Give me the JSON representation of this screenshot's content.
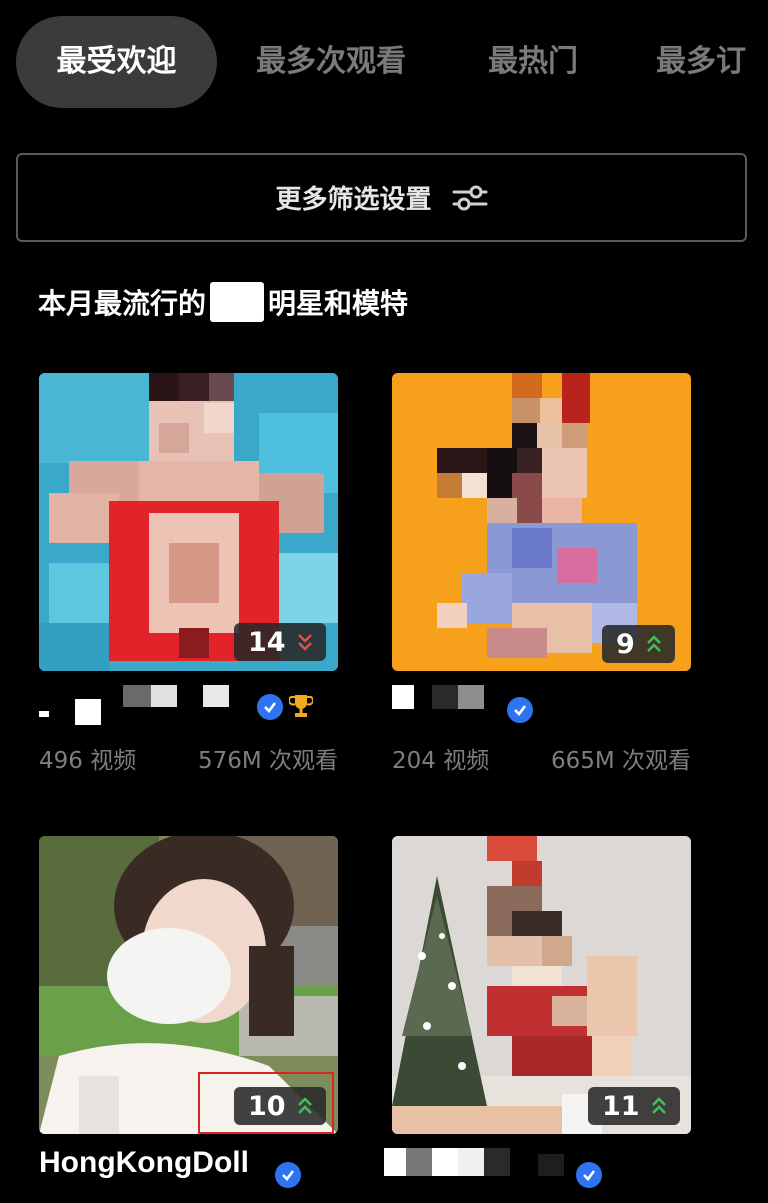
{
  "tabs": [
    {
      "label": "最受欢迎",
      "active": true
    },
    {
      "label": "最多次观看",
      "active": false
    },
    {
      "label": "最热门",
      "active": false
    },
    {
      "label": "最多订",
      "active": false
    }
  ],
  "filter": {
    "label": "更多筛选设置",
    "icon": "sliders-icon"
  },
  "section": {
    "title_before": "本月最流行的",
    "title_after": "明星和模特"
  },
  "cards": [
    {
      "rank": "14",
      "trend": "down",
      "name": "",
      "verified": true,
      "trophy": true,
      "videos": "496 视频",
      "views": "576M 次观看"
    },
    {
      "rank": "9",
      "trend": "up",
      "name": "",
      "verified": true,
      "trophy": false,
      "videos": "204 视频",
      "views": "665M 次观看"
    },
    {
      "rank": "10",
      "trend": "up",
      "name": "HongKongDoll",
      "verified": true,
      "trophy": false,
      "highlighted": true
    },
    {
      "rank": "11",
      "trend": "up",
      "name": "",
      "verified": true,
      "trophy": false
    }
  ],
  "colors": {
    "background": "#000000",
    "tab_active_bg": "#3b3b3b",
    "tab_inactive_text": "#7a7a7a",
    "verified_blue": "#2e74f0",
    "trend_down": "#e0524a",
    "trend_up": "#3fc35a",
    "trophy": "#f2a91c",
    "highlight_border": "#d9261c",
    "thumb1_bg": "#38a6c8",
    "thumb2_bg": "#f6a01b"
  }
}
